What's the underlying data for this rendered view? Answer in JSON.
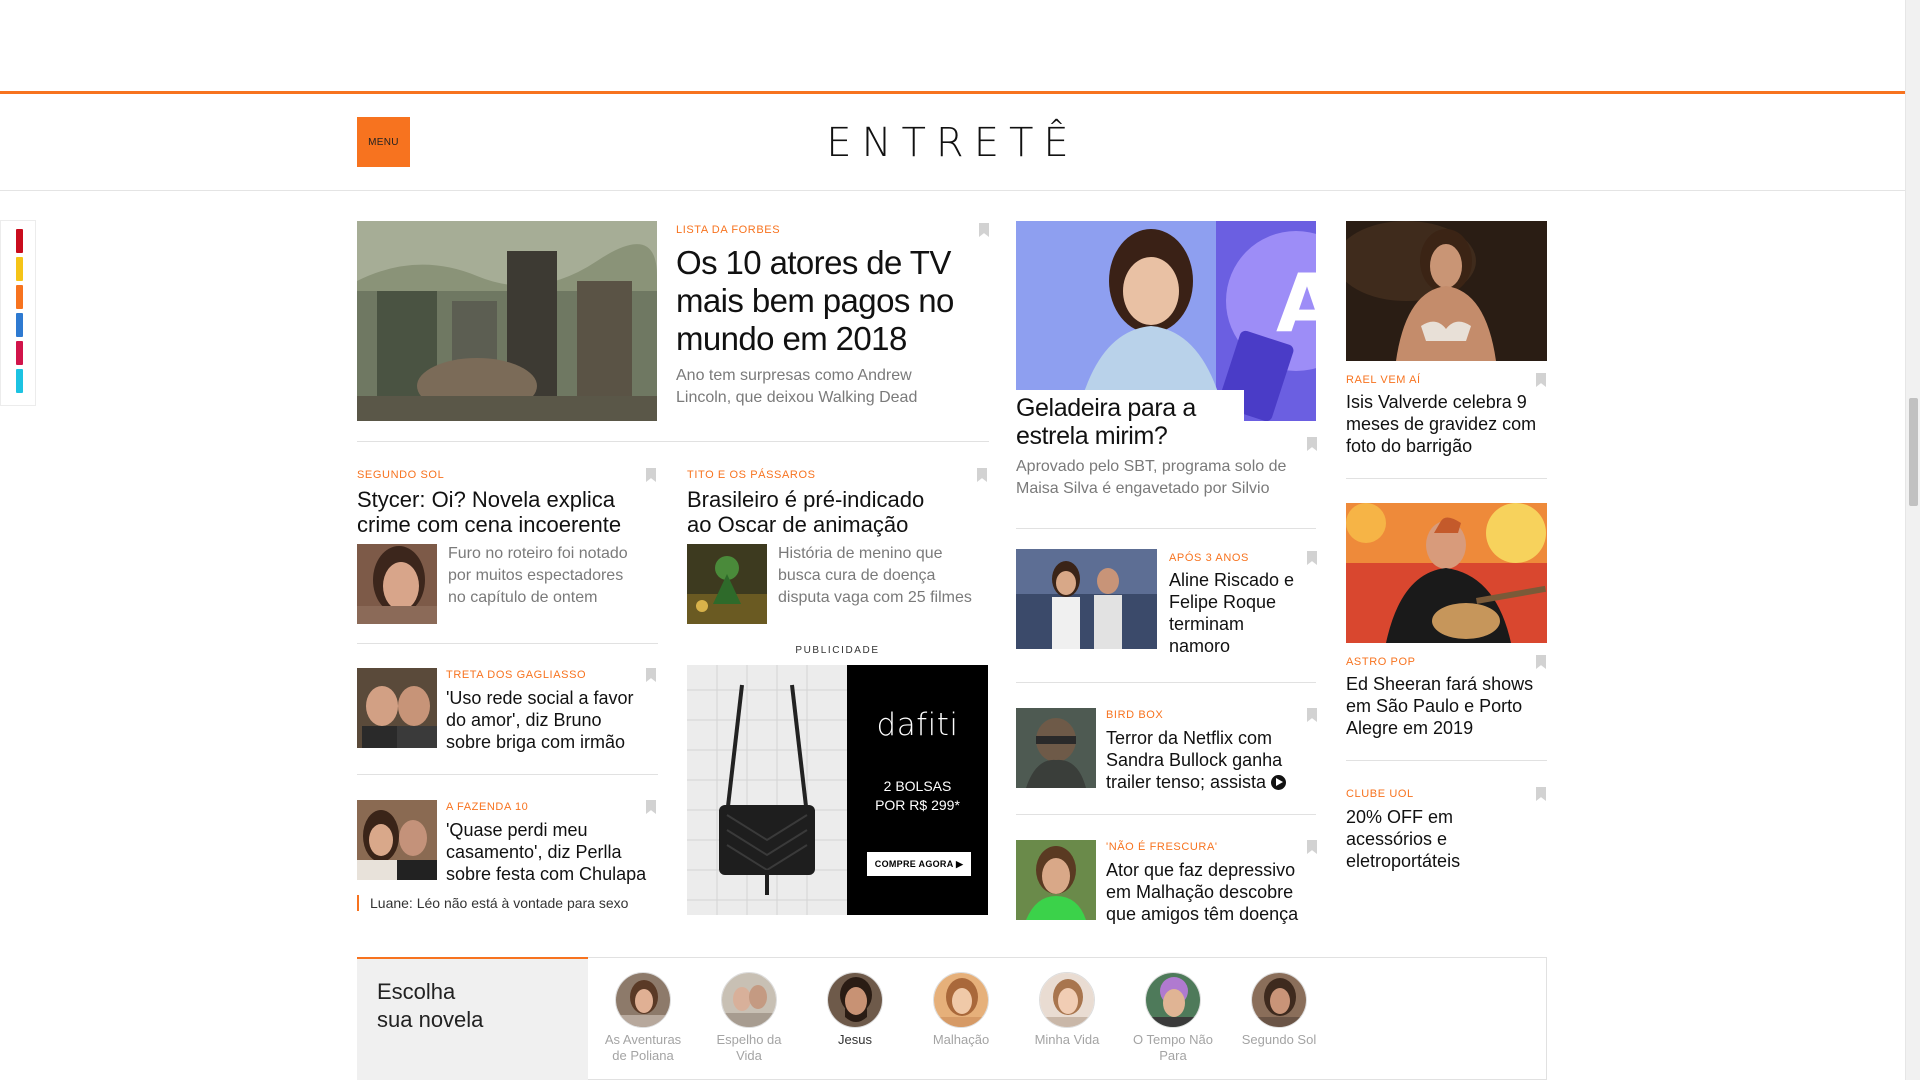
{
  "header": {
    "menu_label": "MENU",
    "logo": "ENTRETÊ",
    "accent": "#f7731f"
  },
  "share_colors": [
    "#c90c1d",
    "#f5c417",
    "#f7731f",
    "#2e7ad1",
    "#d1144a",
    "#1cc3e2"
  ],
  "featured": {
    "tag": "LISTA DA FORBES",
    "title_lines": [
      "Os 10 atores de TV",
      "mais bem pagos no",
      "mundo em 2018"
    ],
    "subtitle_lines": [
      "Ano tem surpresas como Andrew",
      "Lincoln, que deixou Walking Dead"
    ]
  },
  "maisa": {
    "title_lines": [
      "Geladeira para a",
      "estrela mirim?"
    ],
    "subtitle_lines": [
      "Aprovado pelo SBT, programa solo de",
      "Maisa Silva é engavetado por Silvio"
    ],
    "image_badge": "A"
  },
  "isis": {
    "tag": "RAEL VEM AÍ",
    "title_lines": [
      "Isis Valverde celebra 9",
      "meses de gravidez com",
      "foto do barrigão"
    ]
  },
  "ed": {
    "tag": "ASTRO POP",
    "title_lines": [
      "Ed Sheeran fará shows",
      "em São Paulo e Porto",
      "Alegre em 2019"
    ]
  },
  "clube": {
    "tag": "CLUBE UOL",
    "title_lines": [
      "20% OFF em",
      "acessórios e",
      "eletroportáteis"
    ]
  },
  "stycer": {
    "tag": "SEGUNDO SOL",
    "title_lines": [
      "Stycer: Oi? Novela explica",
      "crime com cena incoerente"
    ],
    "subtitle_lines": [
      "Furo no roteiro foi notado",
      "por muitos espectadores",
      "no capítulo de ontem"
    ]
  },
  "tito": {
    "tag": "TITO E OS PÁSSAROS",
    "title_lines": [
      "Brasileiro é pré-indicado",
      "ao Oscar de animação"
    ],
    "subtitle_lines": [
      "História de menino que",
      "busca cura de doença",
      "disputa vaga com 25 filmes"
    ]
  },
  "gagliasso": {
    "tag": "TRETA DOS GAGLIASSO",
    "title_lines": [
      "'Uso rede social a favor",
      "do amor', diz Bruno",
      "sobre briga com irmão"
    ]
  },
  "perlla": {
    "tag": "A FAZENDA 10",
    "title_lines": [
      "'Quase perdi meu",
      "casamento', diz Perlla",
      "sobre festa com Chulapa"
    ]
  },
  "related": "Luane: Léo não está à vontade para sexo",
  "aline": {
    "tag": "APÓS 3 ANOS",
    "title_lines": [
      "Aline Riscado e",
      "Felipe Roque",
      "terminam",
      "namoro"
    ]
  },
  "birdbox": {
    "tag": "BIRD BOX",
    "title_lines": [
      "Terror da Netflix com",
      "Sandra Bullock ganha",
      "trailer tenso; assista"
    ]
  },
  "frescura": {
    "tag": "'NÃO É FRESCURA'",
    "title_lines": [
      "Ator que faz depressivo",
      "em Malhação descobre",
      "que amigos têm doença"
    ]
  },
  "ad": {
    "label": "PUBLICIDADE",
    "brand": "dafiti",
    "offer_line1": "2 BOLSAS",
    "offer_line2": "POR R$ 299*",
    "cta": "COMPRE AGORA ▶"
  },
  "novela": {
    "title_lines": [
      "Escolha",
      "sua novela"
    ],
    "items": [
      {
        "lines": [
          "As Aventuras",
          "de Poliana"
        ],
        "active": false
      },
      {
        "lines": [
          "Espelho da",
          "Vida"
        ],
        "active": false
      },
      {
        "lines": [
          "Jesus"
        ],
        "active": true
      },
      {
        "lines": [
          "Malhação"
        ],
        "active": false
      },
      {
        "lines": [
          "Minha Vida"
        ],
        "active": false
      },
      {
        "lines": [
          "O Tempo Não",
          "Para"
        ],
        "active": false
      },
      {
        "lines": [
          "Segundo Sol"
        ],
        "active": false
      }
    ]
  }
}
